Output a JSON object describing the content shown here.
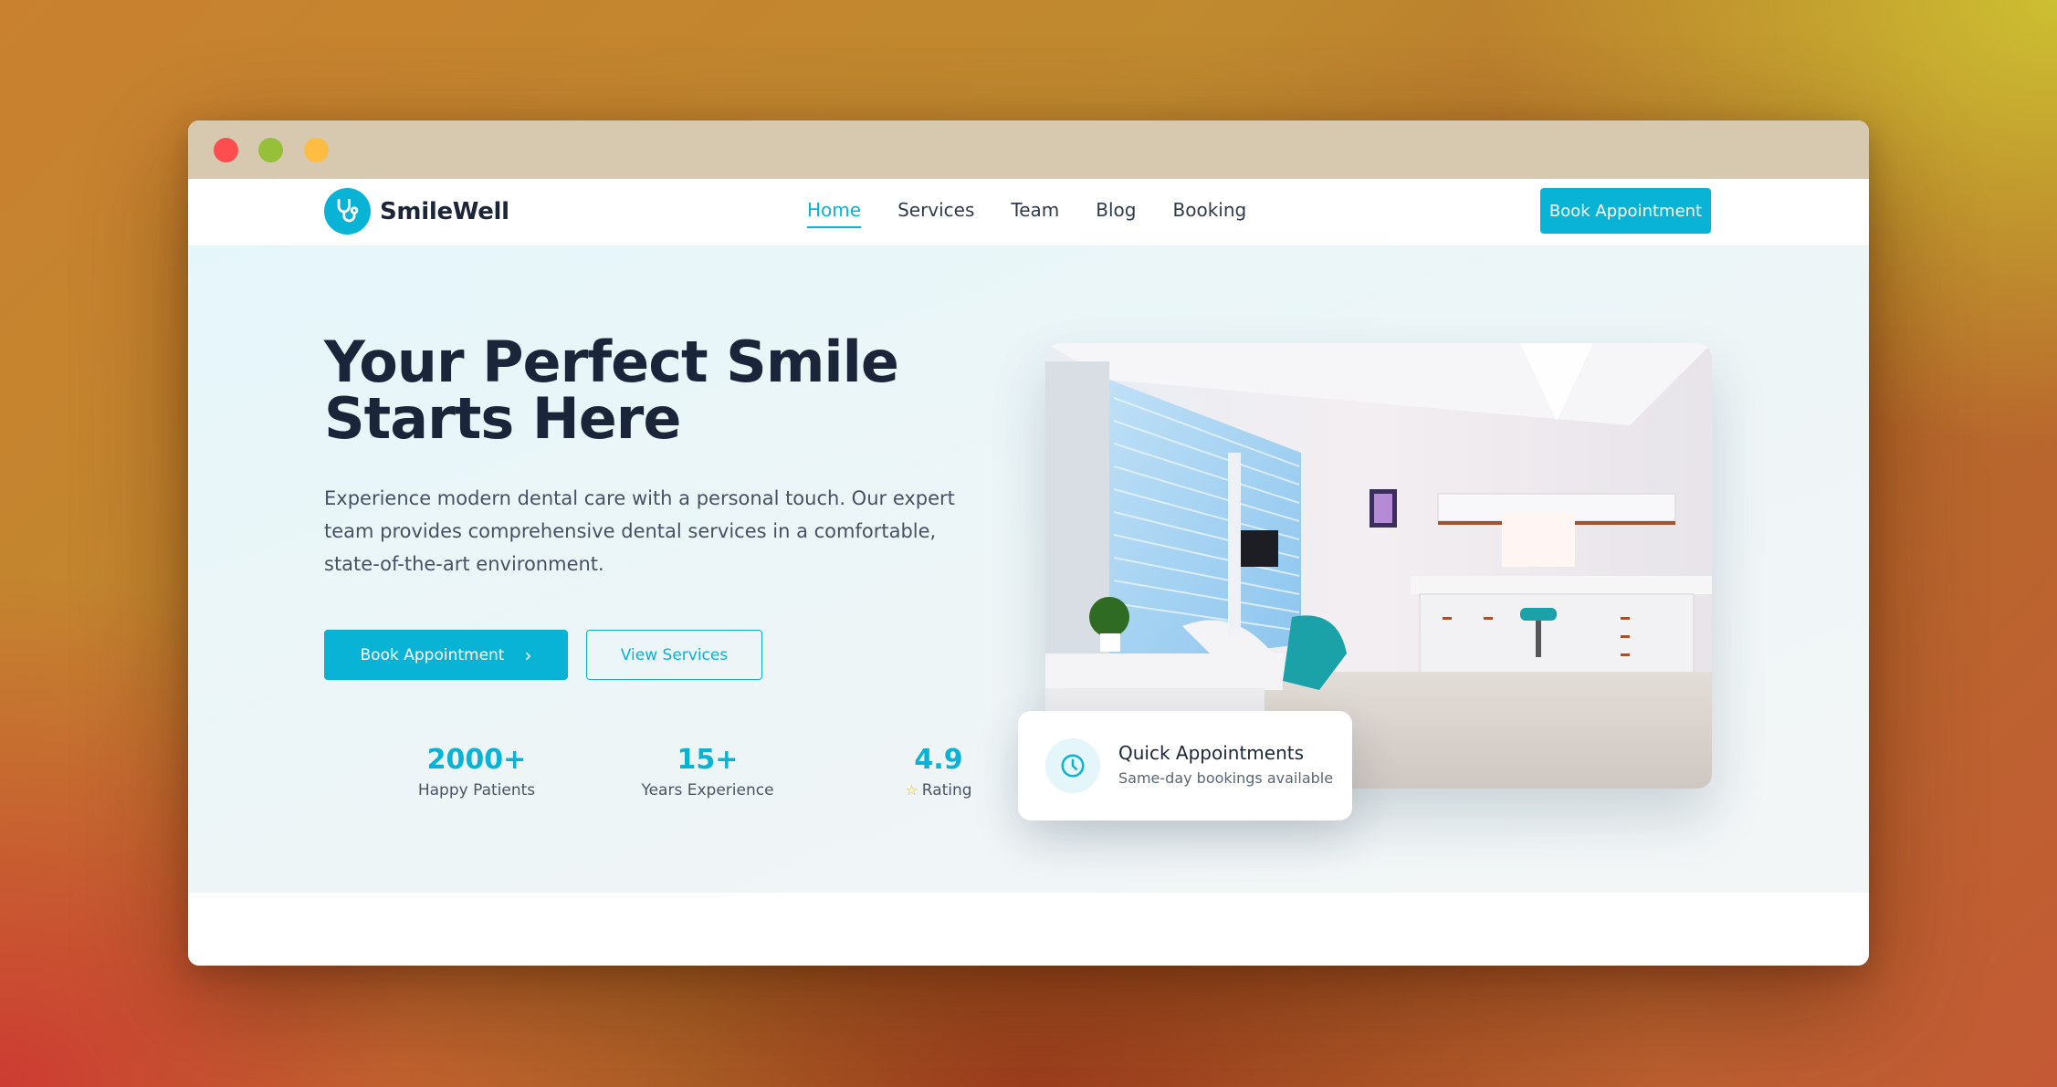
{
  "window": {
    "controls": [
      "close",
      "maximize",
      "minimize"
    ]
  },
  "brand": {
    "name": "SmileWell",
    "icon": "stethoscope-icon"
  },
  "nav": {
    "items": [
      {
        "label": "Home",
        "active": true
      },
      {
        "label": "Services",
        "active": false
      },
      {
        "label": "Team",
        "active": false
      },
      {
        "label": "Blog",
        "active": false
      },
      {
        "label": "Booking",
        "active": false
      }
    ],
    "cta_label": "Book Appointment"
  },
  "hero": {
    "title": "Your Perfect Smile Starts Here",
    "description": "Experience modern dental care with a personal touch. Our expert team provides comprehensive dental services in a comfortable, state-of-the-art environment.",
    "primary_button": "Book Appointment",
    "secondary_button": "View Services",
    "stats": [
      {
        "value": "2000+",
        "label": "Happy Patients"
      },
      {
        "value": "15+",
        "label": "Years Experience"
      },
      {
        "value": "4.9",
        "label": "Rating",
        "icon": "star-icon"
      }
    ]
  },
  "quick_card": {
    "icon": "clock-icon",
    "title": "Quick Appointments",
    "subtitle": "Same-day bookings available"
  },
  "colors": {
    "accent": "#09b3d6",
    "heading": "#1b2539",
    "body_text": "#465264",
    "star": "#f2c012"
  }
}
